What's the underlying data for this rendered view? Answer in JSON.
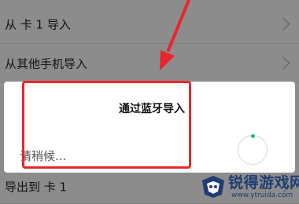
{
  "list": {
    "rows": [
      {
        "label": "从 卡 1 导入"
      },
      {
        "label": "从其他手机导入"
      },
      {
        "label": "导出到 卡 1"
      }
    ]
  },
  "dialog": {
    "title": "通过蓝牙导入",
    "message": "请稍候..."
  },
  "watermark": {
    "name": "锐得游戏网",
    "url": "www.ytruida.com"
  },
  "colors": {
    "accent": "#26b5a2",
    "annotation": "#e8262c"
  }
}
